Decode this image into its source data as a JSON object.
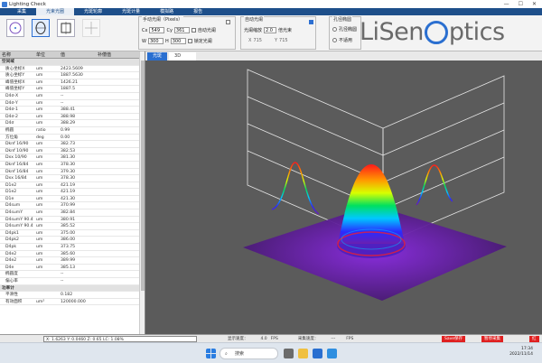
{
  "window": {
    "title": "Lighting Check"
  },
  "menu": [
    {
      "label": "采集"
    },
    {
      "label": "光束光圈"
    },
    {
      "label": "光斑轮廓"
    },
    {
      "label": "光斑计量"
    },
    {
      "label": "模拟路"
    },
    {
      "label": "报告"
    }
  ],
  "toolbar": {
    "group1_title": "手动光阑（Pixels）",
    "cx_label": "Cx",
    "cx_value": "549",
    "cy_label": "Cy",
    "cy_value": "361",
    "w_label": "W",
    "w_value": "300",
    "h_label": "H",
    "h_value": "300",
    "auto_aperture_label": "自动光阑",
    "fix_label": "锁定光阑",
    "lock_label": "锁定光阑",
    "group2_title": "自动光阑",
    "threshold_label": "光阑缩放",
    "threshold_value": "2.0",
    "threshold_unit": "倍光束",
    "x_label": "X",
    "x_value": "715",
    "y_label": "Y",
    "y_value": "715",
    "group3_title": "孔径椭圆",
    "opt1": "孔径椭圆",
    "opt2": "不适用"
  },
  "brand": {
    "text_before": "LiSen",
    "text_after": "ptics"
  },
  "table": {
    "headers": [
      "名称",
      "单位",
      "值",
      "补偿值"
    ],
    "rows": [
      {
        "type": "sec",
        "name": "空间域",
        "unit": "",
        "value": "",
        "comp": ""
      },
      {
        "name": "质心坐标X",
        "unit": "um",
        "value": "2423.5609",
        "comp": ""
      },
      {
        "name": "质心坐标Y",
        "unit": "um",
        "value": "1887.5630",
        "comp": ""
      },
      {
        "name": "峰值坐标X",
        "unit": "um",
        "value": "1426.21",
        "comp": ""
      },
      {
        "name": "峰值坐标Y",
        "unit": "um",
        "value": "1887.5",
        "comp": ""
      },
      {
        "name": "D4σ-X",
        "unit": "um",
        "value": "--",
        "comp": ""
      },
      {
        "name": "D4σ-Y",
        "unit": "um",
        "value": "--",
        "comp": ""
      },
      {
        "name": "D4σ-1",
        "unit": "um",
        "value": "388.41",
        "comp": ""
      },
      {
        "name": "D4σ-2",
        "unit": "um",
        "value": "388.98",
        "comp": ""
      },
      {
        "name": "D4σ",
        "unit": "um",
        "value": "388.29",
        "comp": ""
      },
      {
        "name": "椭圆",
        "unit": "ratio",
        "value": "0.99",
        "comp": ""
      },
      {
        "name": "方位角",
        "unit": "deg",
        "value": "0.00",
        "comp": ""
      },
      {
        "name": "Dknf 16/90",
        "unit": "um",
        "value": "382.73",
        "comp": ""
      },
      {
        "name": "Dknf 10/90",
        "unit": "um",
        "value": "382.53",
        "comp": ""
      },
      {
        "name": "Dxx 10/90",
        "unit": "um",
        "value": "381.30",
        "comp": ""
      },
      {
        "name": "Dknf 16/84",
        "unit": "um",
        "value": "378.30",
        "comp": ""
      },
      {
        "name": "Dknf 16/84",
        "unit": "um",
        "value": "379.30",
        "comp": ""
      },
      {
        "name": "Dxx 16/84",
        "unit": "um",
        "value": "378.30",
        "comp": ""
      },
      {
        "name": "D1e2",
        "unit": "um",
        "value": "421.19",
        "comp": ""
      },
      {
        "name": "D1e2",
        "unit": "um",
        "value": "421.19",
        "comp": ""
      },
      {
        "name": "D1e",
        "unit": "um",
        "value": "421.30",
        "comp": ""
      },
      {
        "name": "D4sum",
        "unit": "um",
        "value": "370.99",
        "comp": ""
      },
      {
        "name": "D4sumY",
        "unit": "um",
        "value": "382.84",
        "comp": ""
      },
      {
        "name": "D4sumY 90.4",
        "unit": "um",
        "value": "380.91",
        "comp": ""
      },
      {
        "name": "D4sumY 90.4",
        "unit": "um",
        "value": "385.52",
        "comp": ""
      },
      {
        "name": "D4pk1",
        "unit": "um",
        "value": "375.00",
        "comp": ""
      },
      {
        "name": "D4pk2",
        "unit": "um",
        "value": "386.00",
        "comp": ""
      },
      {
        "name": "D4pk",
        "unit": "um",
        "value": "373.75",
        "comp": ""
      },
      {
        "name": "D4e2",
        "unit": "um",
        "value": "385.60",
        "comp": ""
      },
      {
        "name": "D4e2",
        "unit": "um",
        "value": "389.99",
        "comp": ""
      },
      {
        "name": "D4e",
        "unit": "um",
        "value": "385.13",
        "comp": ""
      },
      {
        "name": "椭圆度",
        "unit": "",
        "value": "--",
        "comp": ""
      },
      {
        "name": "偏心率",
        "unit": "",
        "value": "--",
        "comp": ""
      },
      {
        "type": "sec",
        "name": "功率计",
        "unit": "",
        "value": "",
        "comp": ""
      },
      {
        "name": "平滑性",
        "unit": "",
        "value": "0.182",
        "comp": ""
      },
      {
        "name": "有效面积",
        "unit": "um²",
        "value": "120000.000",
        "comp": ""
      }
    ]
  },
  "plot": {
    "tab1": "光斑",
    "tab2": "3D"
  },
  "status": {
    "coords": "X: 1.6263  Y: 0.0460  Z: 0.65  LC: 1.08%",
    "fps_label": "显示速度：",
    "fps_value": "4.0",
    "fps_unit": "FPS",
    "capture_label": "采集速度：",
    "capture_value": "---",
    "capture_unit": "FPS",
    "btn1": "Save保存",
    "btn2": "暂停采集",
    "btn3": "红"
  },
  "taskbar": {
    "search_placeholder": "搜索",
    "time": "17:34",
    "date": "2022/11/14"
  },
  "colors": {
    "menu_bg": "#1e4f8a",
    "accent": "#2a6fd0",
    "alert": "#e02020"
  }
}
